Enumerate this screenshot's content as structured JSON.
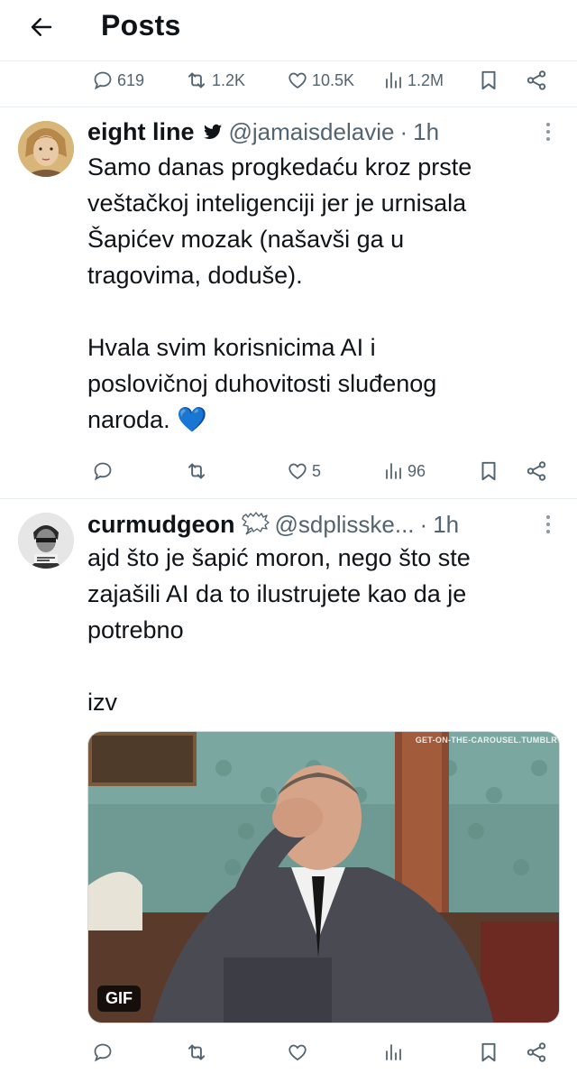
{
  "header": {
    "title": "Posts"
  },
  "top_actions": {
    "replies": "619",
    "reposts": "1.2K",
    "likes": "10.5K",
    "views": "1.2M"
  },
  "tweets": [
    {
      "display_name": "eight line",
      "handle": "@jamaisdelavie",
      "separator": "·",
      "time": "1h",
      "text": "Samo danas progkedaću kroz prste\nveštačkoj inteligenciji jer je urnisala\nŠapićev mozak (našavši ga u\ntragovima, doduše).\n\nHvala svim korisnicima AI i\nposlovičnoj duhovitosti sluđenog\nnaroda. 💙",
      "actions": {
        "replies": "",
        "reposts": "",
        "likes": "5",
        "views": "96"
      }
    },
    {
      "display_name": "curmudgeon",
      "handle": "@sdplisske...",
      "separator": "·",
      "time": "1h",
      "text": "ajd što je šapić moron, nego što ste\nzajašili AI da to ilustrujete kao da je\npotrebno\n\nizv",
      "media": {
        "badge": "GIF",
        "watermark": "GET-ON-THE-CAROUSEL.TUMBLR"
      },
      "actions": {
        "replies": "",
        "reposts": "",
        "likes": "",
        "views": ""
      }
    }
  ],
  "colors": {
    "text": "#0f1419",
    "muted": "#536471",
    "verified": "#0f1419",
    "heart_emoji": "#3b88c3"
  }
}
